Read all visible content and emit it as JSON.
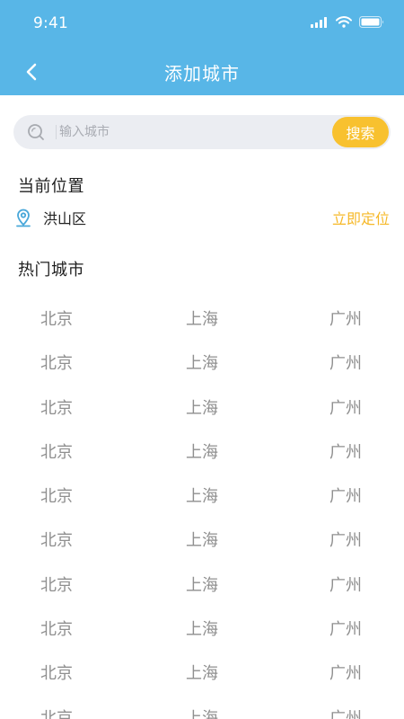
{
  "status": {
    "time": "9:41"
  },
  "nav": {
    "title": "添加城市"
  },
  "search": {
    "placeholder": "输入城市",
    "value": "",
    "button_label": "搜索"
  },
  "current_location": {
    "title": "当前位置",
    "name": "洪山区",
    "locate_label": "立即定位"
  },
  "hot_cities": {
    "title": "热门城市",
    "rows": [
      [
        "北京",
        "上海",
        "广州"
      ],
      [
        "北京",
        "上海",
        "广州"
      ],
      [
        "北京",
        "上海",
        "广州"
      ],
      [
        "北京",
        "上海",
        "广州"
      ],
      [
        "北京",
        "上海",
        "广州"
      ],
      [
        "北京",
        "上海",
        "广州"
      ],
      [
        "北京",
        "上海",
        "广州"
      ],
      [
        "北京",
        "上海",
        "广州"
      ],
      [
        "北京",
        "上海",
        "广州"
      ],
      [
        "北京",
        "上海",
        "广州"
      ]
    ]
  },
  "icons": {
    "signal": "cellular-signal-icon",
    "wifi": "wifi-icon",
    "battery": "battery-icon",
    "back": "chevron-left-icon",
    "search": "search-icon",
    "location": "location-pin-icon"
  },
  "colors": {
    "header": "#58b6e7",
    "accent": "#f8c12f",
    "location_icon": "#48a7d9",
    "city_text": "#8f8f8f"
  }
}
